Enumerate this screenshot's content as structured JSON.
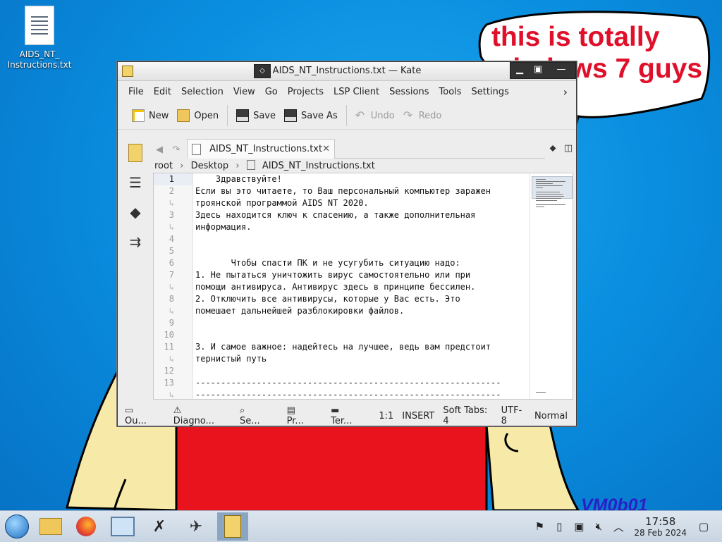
{
  "desktop": {
    "icon_label": "AIDS_NT_\nInstructions.txt",
    "speech_text": "this is totally windows 7 guys",
    "watermark": "VM0b01"
  },
  "window": {
    "title": "AIDS_NT_Instructions.txt — Kate",
    "menu": [
      "File",
      "Edit",
      "Selection",
      "View",
      "Go",
      "Projects",
      "LSP Client",
      "Sessions",
      "Tools",
      "Settings"
    ],
    "menu_more": "›",
    "toolbar": {
      "new": "New",
      "open": "Open",
      "save": "Save",
      "save_as": "Save As",
      "undo": "Undo",
      "redo": "Redo"
    },
    "tab_label": "AIDS_NT_Instructions.txt",
    "tab_close": "✕",
    "breadcrumb": [
      "root",
      "Desktop",
      "AIDS_NT_Instructions.txt"
    ],
    "gutter": [
      "1",
      "2",
      "↳",
      "3",
      "↳",
      "4",
      "5",
      "6",
      "7",
      "↳",
      "8",
      "↳",
      "9",
      "10",
      "11",
      "↳",
      "12",
      "13",
      "↳"
    ],
    "lines": [
      "    Здравствуйте!",
      "Если вы это читаете, то Ваш персональный компьютер заражен",
      "троянской программой AIDS NT 2020.",
      "Здесь находится ключ к спасению, а также дополнительная",
      "информация.",
      "",
      "",
      "       Чтобы спасти ПК и не усугубить ситуацию надо:",
      "1. Не пытаться уничтожить вирус самостоятельно или при",
      "помощи антивируса. Антивирус здесь в принципе бессилен.",
      "2. Отключить все антивирусы, которые у Вас есть. Это",
      "помешает дальнейшей разблокировки файлов.",
      "",
      "",
      "3. И самое важное: надейтесь на лучшее, ведь вам предстоит",
      "тернистый путь",
      "",
      "------------------------------------------------------------",
      "------------------------------------------------------------"
    ],
    "status": {
      "output": "Ou...",
      "diagnostics": "Diagno...",
      "search": "Se...",
      "projects": "Pr...",
      "terminal": "Ter...",
      "position": "1:1",
      "mode": "INSERT",
      "indent": "Soft Tabs: 4",
      "encoding": "UTF-8",
      "syntax": "Normal"
    }
  },
  "taskbar": {
    "time": "17:58",
    "date": "28 Feb 2024"
  }
}
